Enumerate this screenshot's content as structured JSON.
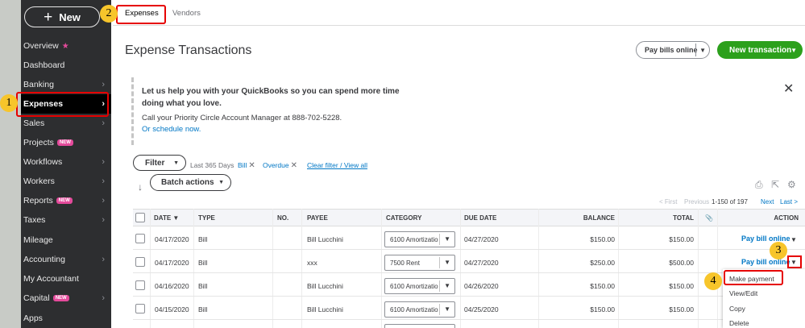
{
  "sidebar": {
    "new_button": "New",
    "items": [
      {
        "label": "Overview"
      },
      {
        "label": "Dashboard"
      },
      {
        "label": "Banking"
      },
      {
        "label": "Expenses"
      },
      {
        "label": "Sales"
      },
      {
        "label": "Projects",
        "badge": "NEW"
      },
      {
        "label": "Workflows"
      },
      {
        "label": "Workers"
      },
      {
        "label": "Reports",
        "badge": "NEW"
      },
      {
        "label": "Taxes"
      },
      {
        "label": "Mileage"
      },
      {
        "label": "Accounting"
      },
      {
        "label": "My Accountant"
      },
      {
        "label": "Capital",
        "badge": "NEW"
      },
      {
        "label": "Apps"
      }
    ]
  },
  "callouts": [
    "1",
    "2",
    "3",
    "4"
  ],
  "tabs": [
    {
      "label": "Expenses"
    },
    {
      "label": "Vendors"
    }
  ],
  "header": {
    "title": "Expense Transactions",
    "pay_bills_online": "Pay bills online",
    "new_transaction": "New transaction"
  },
  "banner": {
    "headline": "Let us help you with your QuickBooks so you can spend more time doing what you love.",
    "call_text": "Call your Priority Circle Account Manager at 888-702-5228.",
    "schedule_link": "Or schedule now."
  },
  "filters": {
    "filter_button": "Filter",
    "range": "Last 365 Days",
    "chips": [
      "Bill",
      "Overdue"
    ],
    "clear_link": "Clear filter / View all",
    "batch_actions": "Batch actions"
  },
  "pagination": {
    "first": "< First",
    "previous": "Previous",
    "range": "1-150 of 197",
    "next": "Next",
    "last": "Last >"
  },
  "table": {
    "columns": [
      "DATE",
      "TYPE",
      "NO.",
      "PAYEE",
      "CATEGORY",
      "DUE DATE",
      "BALANCE",
      "TOTAL",
      "ACTION"
    ],
    "rows": [
      {
        "date": "04/17/2020",
        "type": "Bill",
        "no": "",
        "payee": "Bill Lucchini",
        "category": "6100 Amortizatio",
        "due_date": "04/27/2020",
        "balance": "$150.00",
        "total": "$150.00",
        "action": "Pay bill online"
      },
      {
        "date": "04/17/2020",
        "type": "Bill",
        "no": "",
        "payee": "xxx",
        "category": "7500 Rent",
        "due_date": "04/27/2020",
        "balance": "$250.00",
        "total": "$500.00",
        "action": "Pay bill online"
      },
      {
        "date": "04/16/2020",
        "type": "Bill",
        "no": "",
        "payee": "Bill Lucchini",
        "category": "6100 Amortizatio",
        "due_date": "04/26/2020",
        "balance": "$150.00",
        "total": "$150.00",
        "action": ""
      },
      {
        "date": "04/15/2020",
        "type": "Bill",
        "no": "",
        "payee": "Bill Lucchini",
        "category": "6100 Amortizatio",
        "due_date": "04/25/2020",
        "balance": "$150.00",
        "total": "$150.00",
        "action": ""
      }
    ]
  },
  "action_menu": [
    "Make payment",
    "View/Edit",
    "Copy",
    "Delete"
  ],
  "colors": {
    "sidebar_bg": "#2d2e30",
    "accent_green": "#2ca01c",
    "link_blue": "#0077c5",
    "highlight_red": "#e60000",
    "callout_yellow": "#f7c52b"
  }
}
